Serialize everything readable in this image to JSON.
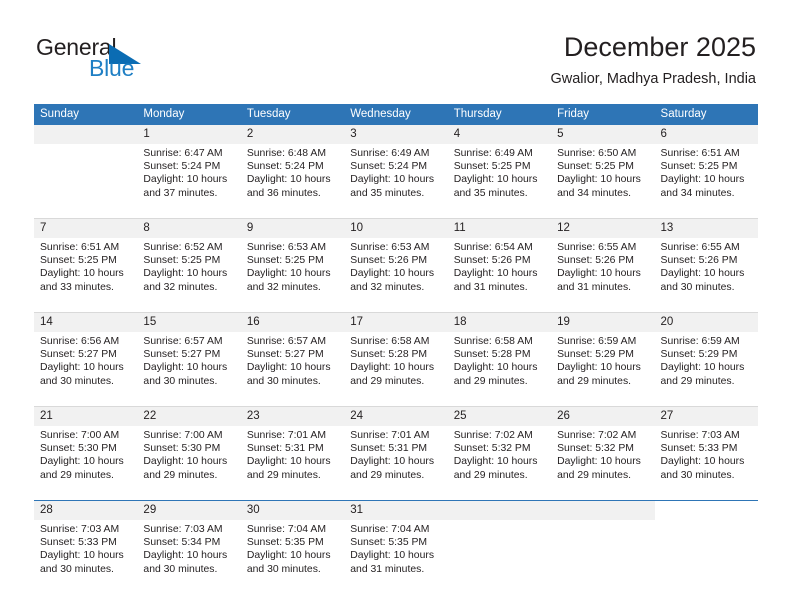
{
  "logo": {
    "primary_text": "General",
    "secondary_text": "Blue",
    "triangle_color": "#0b6cb3",
    "secondary_color": "#1f7fc4"
  },
  "header": {
    "title": "December 2025",
    "subtitle": "Gwalior, Madhya Pradesh, India"
  },
  "theme": {
    "header_row_bg": "#2e75b6",
    "header_row_text": "#ffffff",
    "day_number_bg": "#f1f1f1",
    "cell_text": "#231f20",
    "page_bg": "#ffffff"
  },
  "calendar": {
    "weekday_headers": [
      "Sunday",
      "Monday",
      "Tuesday",
      "Wednesday",
      "Thursday",
      "Friday",
      "Saturday"
    ],
    "weeks": [
      {
        "days": [
          {
            "number": "",
            "sunrise": "",
            "sunset": "",
            "daylight_line1": "",
            "daylight_line2": ""
          },
          {
            "number": "1",
            "sunrise": "Sunrise: 6:47 AM",
            "sunset": "Sunset: 5:24 PM",
            "daylight_line1": "Daylight: 10 hours",
            "daylight_line2": "and 37 minutes."
          },
          {
            "number": "2",
            "sunrise": "Sunrise: 6:48 AM",
            "sunset": "Sunset: 5:24 PM",
            "daylight_line1": "Daylight: 10 hours",
            "daylight_line2": "and 36 minutes."
          },
          {
            "number": "3",
            "sunrise": "Sunrise: 6:49 AM",
            "sunset": "Sunset: 5:24 PM",
            "daylight_line1": "Daylight: 10 hours",
            "daylight_line2": "and 35 minutes."
          },
          {
            "number": "4",
            "sunrise": "Sunrise: 6:49 AM",
            "sunset": "Sunset: 5:25 PM",
            "daylight_line1": "Daylight: 10 hours",
            "daylight_line2": "and 35 minutes."
          },
          {
            "number": "5",
            "sunrise": "Sunrise: 6:50 AM",
            "sunset": "Sunset: 5:25 PM",
            "daylight_line1": "Daylight: 10 hours",
            "daylight_line2": "and 34 minutes."
          },
          {
            "number": "6",
            "sunrise": "Sunrise: 6:51 AM",
            "sunset": "Sunset: 5:25 PM",
            "daylight_line1": "Daylight: 10 hours",
            "daylight_line2": "and 34 minutes."
          }
        ]
      },
      {
        "days": [
          {
            "number": "7",
            "sunrise": "Sunrise: 6:51 AM",
            "sunset": "Sunset: 5:25 PM",
            "daylight_line1": "Daylight: 10 hours",
            "daylight_line2": "and 33 minutes."
          },
          {
            "number": "8",
            "sunrise": "Sunrise: 6:52 AM",
            "sunset": "Sunset: 5:25 PM",
            "daylight_line1": "Daylight: 10 hours",
            "daylight_line2": "and 32 minutes."
          },
          {
            "number": "9",
            "sunrise": "Sunrise: 6:53 AM",
            "sunset": "Sunset: 5:25 PM",
            "daylight_line1": "Daylight: 10 hours",
            "daylight_line2": "and 32 minutes."
          },
          {
            "number": "10",
            "sunrise": "Sunrise: 6:53 AM",
            "sunset": "Sunset: 5:26 PM",
            "daylight_line1": "Daylight: 10 hours",
            "daylight_line2": "and 32 minutes."
          },
          {
            "number": "11",
            "sunrise": "Sunrise: 6:54 AM",
            "sunset": "Sunset: 5:26 PM",
            "daylight_line1": "Daylight: 10 hours",
            "daylight_line2": "and 31 minutes."
          },
          {
            "number": "12",
            "sunrise": "Sunrise: 6:55 AM",
            "sunset": "Sunset: 5:26 PM",
            "daylight_line1": "Daylight: 10 hours",
            "daylight_line2": "and 31 minutes."
          },
          {
            "number": "13",
            "sunrise": "Sunrise: 6:55 AM",
            "sunset": "Sunset: 5:26 PM",
            "daylight_line1": "Daylight: 10 hours",
            "daylight_line2": "and 30 minutes."
          }
        ]
      },
      {
        "days": [
          {
            "number": "14",
            "sunrise": "Sunrise: 6:56 AM",
            "sunset": "Sunset: 5:27 PM",
            "daylight_line1": "Daylight: 10 hours",
            "daylight_line2": "and 30 minutes."
          },
          {
            "number": "15",
            "sunrise": "Sunrise: 6:57 AM",
            "sunset": "Sunset: 5:27 PM",
            "daylight_line1": "Daylight: 10 hours",
            "daylight_line2": "and 30 minutes."
          },
          {
            "number": "16",
            "sunrise": "Sunrise: 6:57 AM",
            "sunset": "Sunset: 5:27 PM",
            "daylight_line1": "Daylight: 10 hours",
            "daylight_line2": "and 30 minutes."
          },
          {
            "number": "17",
            "sunrise": "Sunrise: 6:58 AM",
            "sunset": "Sunset: 5:28 PM",
            "daylight_line1": "Daylight: 10 hours",
            "daylight_line2": "and 29 minutes."
          },
          {
            "number": "18",
            "sunrise": "Sunrise: 6:58 AM",
            "sunset": "Sunset: 5:28 PM",
            "daylight_line1": "Daylight: 10 hours",
            "daylight_line2": "and 29 minutes."
          },
          {
            "number": "19",
            "sunrise": "Sunrise: 6:59 AM",
            "sunset": "Sunset: 5:29 PM",
            "daylight_line1": "Daylight: 10 hours",
            "daylight_line2": "and 29 minutes."
          },
          {
            "number": "20",
            "sunrise": "Sunrise: 6:59 AM",
            "sunset": "Sunset: 5:29 PM",
            "daylight_line1": "Daylight: 10 hours",
            "daylight_line2": "and 29 minutes."
          }
        ]
      },
      {
        "days": [
          {
            "number": "21",
            "sunrise": "Sunrise: 7:00 AM",
            "sunset": "Sunset: 5:30 PM",
            "daylight_line1": "Daylight: 10 hours",
            "daylight_line2": "and 29 minutes."
          },
          {
            "number": "22",
            "sunrise": "Sunrise: 7:00 AM",
            "sunset": "Sunset: 5:30 PM",
            "daylight_line1": "Daylight: 10 hours",
            "daylight_line2": "and 29 minutes."
          },
          {
            "number": "23",
            "sunrise": "Sunrise: 7:01 AM",
            "sunset": "Sunset: 5:31 PM",
            "daylight_line1": "Daylight: 10 hours",
            "daylight_line2": "and 29 minutes."
          },
          {
            "number": "24",
            "sunrise": "Sunrise: 7:01 AM",
            "sunset": "Sunset: 5:31 PM",
            "daylight_line1": "Daylight: 10 hours",
            "daylight_line2": "and 29 minutes."
          },
          {
            "number": "25",
            "sunrise": "Sunrise: 7:02 AM",
            "sunset": "Sunset: 5:32 PM",
            "daylight_line1": "Daylight: 10 hours",
            "daylight_line2": "and 29 minutes."
          },
          {
            "number": "26",
            "sunrise": "Sunrise: 7:02 AM",
            "sunset": "Sunset: 5:32 PM",
            "daylight_line1": "Daylight: 10 hours",
            "daylight_line2": "and 29 minutes."
          },
          {
            "number": "27",
            "sunrise": "Sunrise: 7:03 AM",
            "sunset": "Sunset: 5:33 PM",
            "daylight_line1": "Daylight: 10 hours",
            "daylight_line2": "and 30 minutes."
          }
        ]
      },
      {
        "days": [
          {
            "number": "28",
            "sunrise": "Sunrise: 7:03 AM",
            "sunset": "Sunset: 5:33 PM",
            "daylight_line1": "Daylight: 10 hours",
            "daylight_line2": "and 30 minutes."
          },
          {
            "number": "29",
            "sunrise": "Sunrise: 7:03 AM",
            "sunset": "Sunset: 5:34 PM",
            "daylight_line1": "Daylight: 10 hours",
            "daylight_line2": "and 30 minutes."
          },
          {
            "number": "30",
            "sunrise": "Sunrise: 7:04 AM",
            "sunset": "Sunset: 5:35 PM",
            "daylight_line1": "Daylight: 10 hours",
            "daylight_line2": "and 30 minutes."
          },
          {
            "number": "31",
            "sunrise": "Sunrise: 7:04 AM",
            "sunset": "Sunset: 5:35 PM",
            "daylight_line1": "Daylight: 10 hours",
            "daylight_line2": "and 31 minutes."
          },
          {
            "number": "",
            "sunrise": "",
            "sunset": "",
            "daylight_line1": "",
            "daylight_line2": ""
          },
          {
            "number": "",
            "sunrise": "",
            "sunset": "",
            "daylight_line1": "",
            "daylight_line2": ""
          },
          {
            "number": "",
            "sunrise": "",
            "sunset": "",
            "daylight_line1": "",
            "daylight_line2": ""
          }
        ]
      }
    ]
  }
}
